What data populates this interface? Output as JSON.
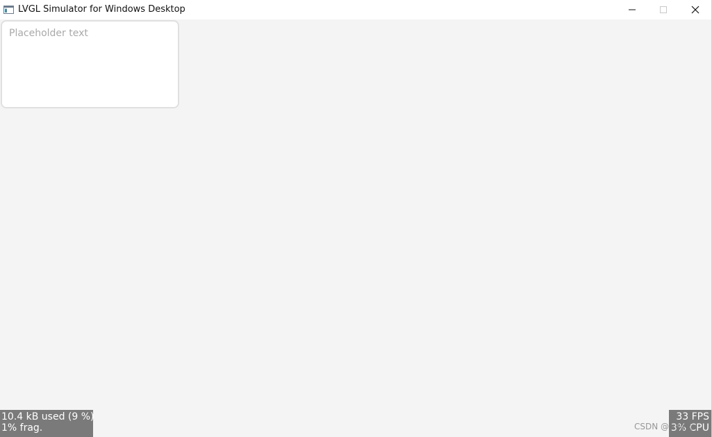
{
  "window": {
    "title": "LVGL Simulator for Windows Desktop",
    "icon": "app-window-icon",
    "controls": {
      "minimize_icon": "minimize-icon",
      "maximize_icon": "maximize-icon",
      "close_icon": "close-icon"
    }
  },
  "textarea": {
    "placeholder": "Placeholder text",
    "value": ""
  },
  "perf_monitor": {
    "mem_used": "10.4 kB used (9 %)",
    "mem_frag": "1% frag.",
    "fps": "33 FPS",
    "cpu": "3% CPU"
  },
  "watermark": {
    "text": "CSDN @lx科技"
  },
  "colors": {
    "background": "#f4f4f4",
    "titlebar": "#ffffff",
    "perf_bg": "#7a7a7a",
    "placeholder": "#a9a9a9",
    "textarea_border": "#e0e0e0"
  }
}
